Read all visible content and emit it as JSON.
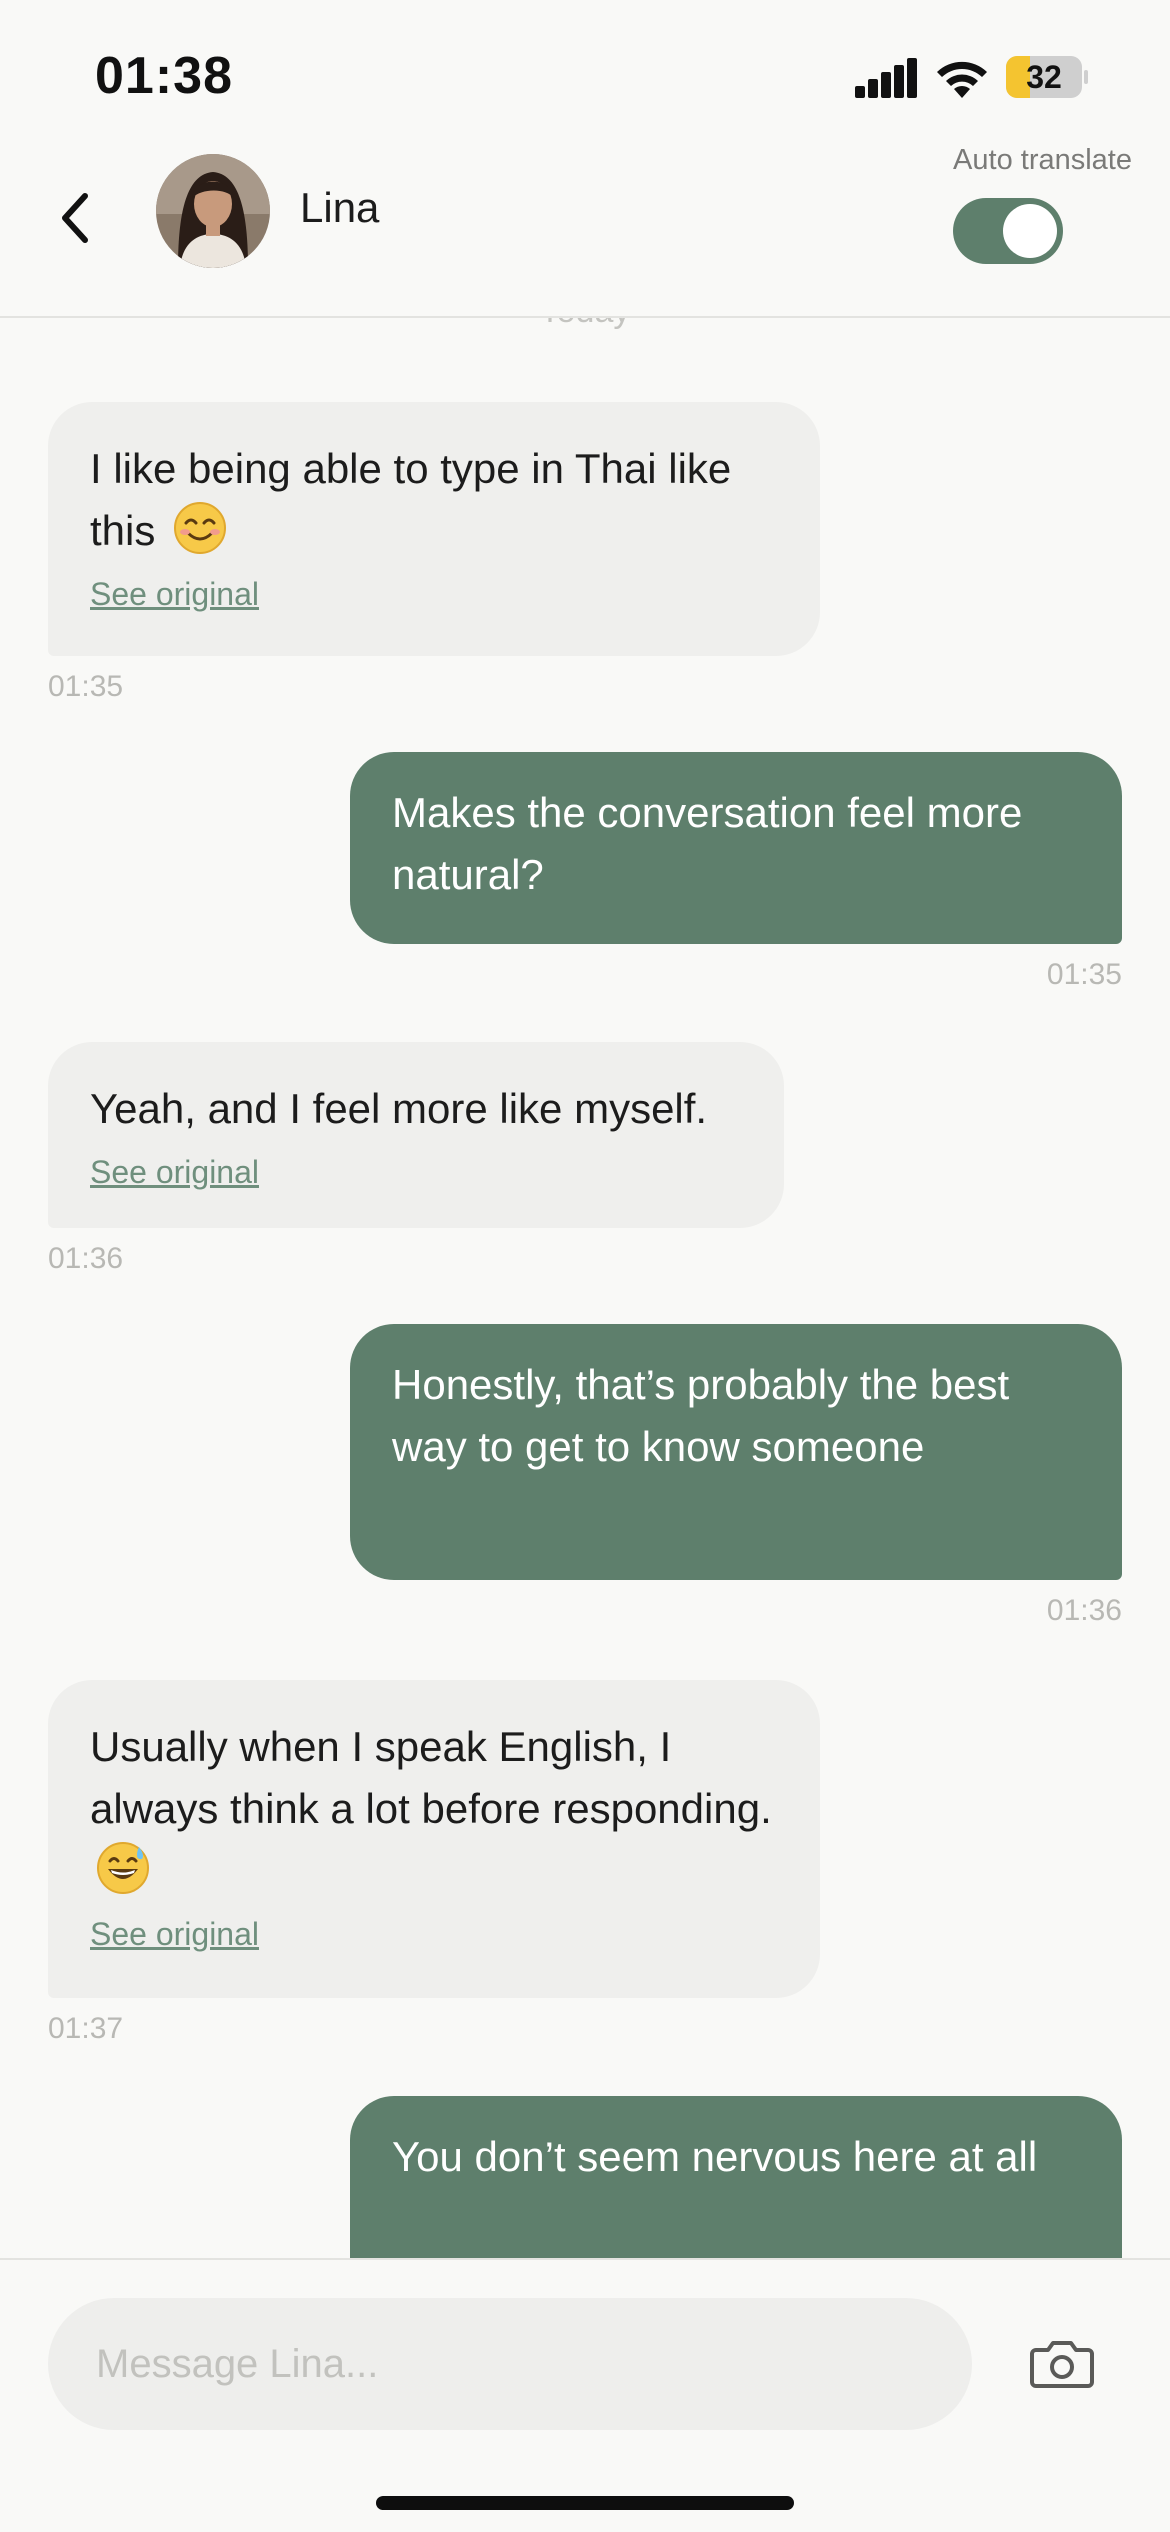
{
  "status_bar": {
    "time": "01:38",
    "battery_percent": "32",
    "battery_level": 0.32,
    "signal_icon": "cellular-signal-icon",
    "wifi_icon": "wifi-icon"
  },
  "header": {
    "back_icon": "chevron-left-icon",
    "contact_name": "Lina",
    "auto_translate_label": "Auto translate",
    "auto_translate_on": true
  },
  "conversation": {
    "day_label": "Today",
    "see_original_label": "See original",
    "messages": [
      {
        "direction": "in",
        "text": "I like being able to type in Thai like this",
        "emoji": "smiling-face-emoji",
        "time": "01:35"
      },
      {
        "direction": "out",
        "text": "Makes the conversation feel more natural?",
        "time": "01:35"
      },
      {
        "direction": "in",
        "text": "Yeah, and I feel more like myself.",
        "time": "01:36"
      },
      {
        "direction": "out",
        "text": "Honestly, that’s probably the best way to get to know someone",
        "time": "01:36"
      },
      {
        "direction": "in",
        "text": "Usually when I speak English, I always think a lot before responding.",
        "emoji": "grinning-sweat-emoji",
        "time": "01:37"
      },
      {
        "direction": "out",
        "text": "You don’t seem nervous here at all"
      }
    ]
  },
  "composer": {
    "placeholder": "Message Lina...",
    "camera_icon": "camera-icon"
  },
  "colors": {
    "accent_green": "#5e7f6c",
    "incoming_bubble": "#efefed",
    "background": "#f9f9f7",
    "link_green": "#6f8f7d"
  }
}
